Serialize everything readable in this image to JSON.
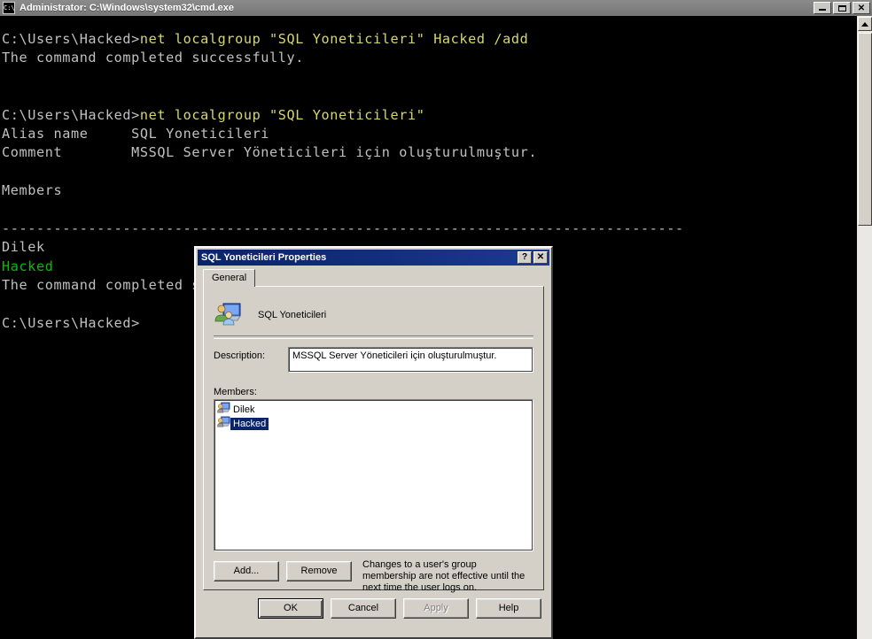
{
  "console_window": {
    "title": "Administrator: C:\\Windows\\system32\\cmd.exe",
    "icon": "cmd-icon",
    "icon_glyph": "C:\\",
    "window_buttons": {
      "minimize": "minimize-button",
      "maximize": "maximize-button",
      "close_label": "✕"
    },
    "lines": [
      {
        "prompt": "C:\\Users\\Hacked>",
        "command": "net localgroup \"SQL Yoneticileri\" Hacked /add"
      },
      {
        "text": "The command completed successfully."
      },
      {
        "text": ""
      },
      {
        "text": ""
      },
      {
        "prompt": "C:\\Users\\Hacked>",
        "command": "net localgroup \"SQL Yoneticileri\""
      },
      {
        "text": "Alias name     SQL Yoneticileri"
      },
      {
        "text": "Comment        MSSQL Server Yöneticileri için oluşturulmuştur."
      },
      {
        "text": ""
      },
      {
        "text": "Members"
      },
      {
        "text": ""
      },
      {
        "text": "-------------------------------------------------------------------------------"
      },
      {
        "text": "Dilek"
      },
      {
        "text": "Hacked",
        "color": "green"
      },
      {
        "text": "The command completed successfully."
      },
      {
        "text": ""
      },
      {
        "prompt": "C:\\Users\\Hacked>",
        "command": ""
      }
    ],
    "colors": {
      "background": "#000000",
      "text": "#c0c0c0",
      "command": "#d7d76a",
      "highlight": "#00c000",
      "titlebar": "#808080"
    }
  },
  "dialog": {
    "title": "SQL Yoneticileri Properties",
    "help_button_label": "?",
    "close_button_label": "✕",
    "tabs": [
      {
        "label": "General",
        "selected": true
      }
    ],
    "group_icon": "group-icon",
    "group_name": "SQL Yoneticileri",
    "description": {
      "label": "Description:",
      "value": "MSSQL Server Yöneticileri için oluşturulmuştur."
    },
    "members": {
      "label": "Members:",
      "items": [
        {
          "name": "Dilek",
          "icon": "user-icon",
          "selected": false
        },
        {
          "name": "Hacked",
          "icon": "user-icon",
          "selected": true
        }
      ]
    },
    "add_button": "Add...",
    "remove_button": "Remove",
    "membership_note": "Changes to a user's group membership are not effective until the next time the user logs on.",
    "buttons": [
      {
        "label": "OK",
        "enabled": true,
        "default": true
      },
      {
        "label": "Cancel",
        "enabled": true,
        "default": false
      },
      {
        "label": "Apply",
        "enabled": false,
        "default": false
      },
      {
        "label": "Help",
        "enabled": true,
        "default": false
      }
    ],
    "colors": {
      "face": "#d4d0c8",
      "titlebar_start": "#0a246a",
      "titlebar_end": "#1c3a94",
      "selection": "#0a246a"
    }
  }
}
